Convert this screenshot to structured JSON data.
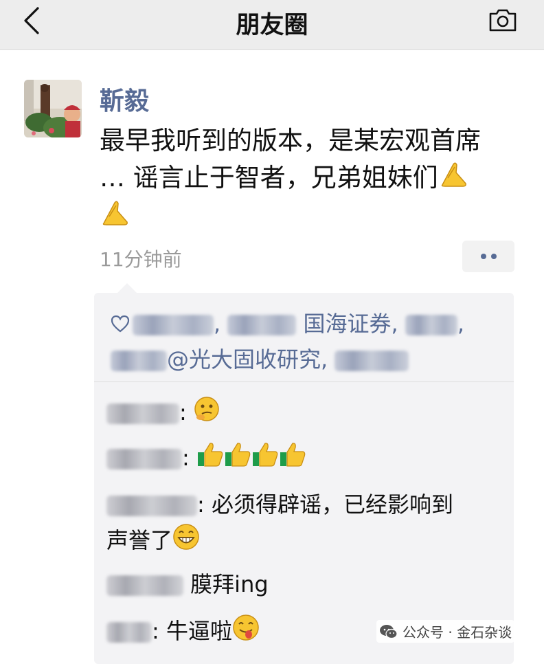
{
  "header": {
    "title": "朋友圈",
    "back_icon": "chevron-left-icon",
    "camera_icon": "camera-icon"
  },
  "post": {
    "author": "靳毅",
    "text_line1": "最早我听到的版本，是某宏观首席",
    "text_line2": "… 谣言止于智者，兄弟姐妹们",
    "emoji": "folded-hands-icon",
    "timestamp": "11分钟前",
    "more_icon": "more-dots-icon"
  },
  "likes": {
    "icon": "heart-outline-icon",
    "visible_names": [
      "国海证券",
      "@光大固收研究"
    ],
    "separator": ", "
  },
  "comments": [
    {
      "sep": ":",
      "text": "",
      "emoji": [
        "thinking-face-icon"
      ]
    },
    {
      "sep": ":",
      "text": "",
      "emoji": [
        "thumbs-up-icon",
        "thumbs-up-icon",
        "thumbs-up-icon",
        "thumbs-up-icon"
      ]
    },
    {
      "sep": ":",
      "text": "必须得辟谣，已经影响到",
      "text2": "声誉了",
      "emoji": [
        "grinning-face-icon"
      ]
    },
    {
      "sep": "",
      "text": "膜拜ing",
      "emoji": []
    },
    {
      "sep": ":",
      "text": "牛逼啦",
      "emoji": [
        "yum-face-icon"
      ]
    }
  ],
  "watermark": {
    "text": "公众号 · 金石杂谈",
    "icon": "wechat-icon"
  },
  "colors": {
    "link_blue": "#576b95",
    "bar_bg": "#ededed",
    "box_bg": "#f3f3f5"
  }
}
